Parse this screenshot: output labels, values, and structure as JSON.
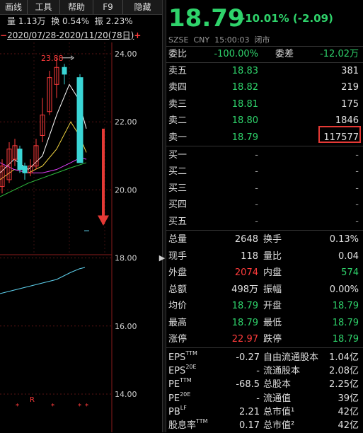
{
  "toolbar": {
    "items": [
      "画线",
      "工具",
      "帮助",
      "F9",
      "隐藏"
    ]
  },
  "info": {
    "volume": "量 1.13万",
    "turnover": "换 0.54%",
    "amplitude": "振 2.23%"
  },
  "range": {
    "minus": "−",
    "text": "2020/07/28-2020/11/20(78日)",
    "plus": "+"
  },
  "chart": {
    "max_label": "23.88",
    "axis_labels": [
      "24.00",
      "22.00",
      "20.00",
      "18.00",
      "16.00",
      "14.00"
    ],
    "marks": [
      "*",
      "R",
      "*",
      "*",
      "*"
    ]
  },
  "chart_data": {
    "type": "candlestick",
    "ylim": [
      13.6,
      24.4
    ],
    "y_ticks": [
      24,
      22,
      20,
      18,
      16,
      14
    ],
    "max_annotation": 23.88,
    "candles": [
      {
        "o": 20.1,
        "c": 20.7,
        "h": 20.9,
        "l": 19.9,
        "up": true
      },
      {
        "o": 20.3,
        "c": 21.2,
        "h": 21.4,
        "l": 20.2,
        "up": true
      },
      {
        "o": 20.9,
        "c": 21.3,
        "h": 21.5,
        "l": 20.7,
        "up": true
      },
      {
        "o": 20.6,
        "c": 21.2,
        "h": 21.3,
        "l": 20.5,
        "up": false
      },
      {
        "o": 20.5,
        "c": 20.7,
        "h": 20.8,
        "l": 20.3,
        "up": false
      },
      {
        "o": 20.5,
        "c": 20.7,
        "h": 20.9,
        "l": 20.4,
        "up": true
      },
      {
        "o": 20.7,
        "c": 21.3,
        "h": 21.5,
        "l": 20.6,
        "up": true
      },
      {
        "o": 21.6,
        "c": 22.2,
        "h": 22.7,
        "l": 21.4,
        "up": true
      },
      {
        "o": 22.3,
        "c": 23.3,
        "h": 23.5,
        "l": 22.2,
        "up": true
      },
      {
        "o": 23.1,
        "c": 23.6,
        "h": 23.88,
        "l": 22.7,
        "up": true
      },
      {
        "o": 23.6,
        "c": 23.4,
        "h": 23.7,
        "l": 23.1,
        "up": false
      },
      {
        "o": 23.3,
        "c": 20.8,
        "h": 23.4,
        "l": 20.8,
        "up": false
      }
    ],
    "lower": {
      "type": "line",
      "color": "#5fd3f0"
    }
  },
  "quote": {
    "price": "18.79",
    "change": "-10.01% (-2.09)",
    "exchange": "SZSE",
    "currency": "CNY",
    "time": "15:00:03",
    "status": "闭市",
    "weibi_label": "委比",
    "weibi_value": "-100.00%",
    "weicha_label": "委差",
    "weicha_value": "-12.02万",
    "sell": [
      {
        "label": "卖五",
        "price": "18.83",
        "vol": "381"
      },
      {
        "label": "卖四",
        "price": "18.82",
        "vol": "219"
      },
      {
        "label": "卖三",
        "price": "18.81",
        "vol": "175"
      },
      {
        "label": "卖二",
        "price": "18.80",
        "vol": "1846"
      },
      {
        "label": "卖一",
        "price": "18.79",
        "vol": "117577"
      }
    ],
    "buy": [
      {
        "label": "买一",
        "price": "-",
        "vol": "-"
      },
      {
        "label": "买二",
        "price": "-",
        "vol": "-"
      },
      {
        "label": "买三",
        "price": "-",
        "vol": "-"
      },
      {
        "label": "买四",
        "price": "-",
        "vol": "-"
      },
      {
        "label": "买五",
        "price": "-",
        "vol": "-"
      }
    ],
    "stats": [
      {
        "l1": "总量",
        "v1": "2648",
        "c1": "w",
        "l2": "换手",
        "v2": "0.13%",
        "c2": "w"
      },
      {
        "l1": "现手",
        "v1": "118",
        "c1": "w",
        "l2": "量比",
        "v2": "0.04",
        "c2": "w"
      },
      {
        "l1": "外盘",
        "v1": "2074",
        "c1": "r",
        "l2": "内盘",
        "v2": "574",
        "c2": "g"
      },
      {
        "l1": "总额",
        "v1": "498万",
        "c1": "w",
        "l2": "振幅",
        "v2": "0.00%",
        "c2": "w"
      },
      {
        "l1": "均价",
        "v1": "18.79",
        "c1": "g",
        "l2": "开盘",
        "v2": "18.79",
        "c2": "g"
      },
      {
        "l1": "最高",
        "v1": "18.79",
        "c1": "g",
        "l2": "最低",
        "v2": "18.79",
        "c2": "g"
      },
      {
        "l1": "涨停",
        "v1": "22.97",
        "c1": "r",
        "l2": "跌停",
        "v2": "18.79",
        "c2": "g"
      }
    ],
    "fundamentals": [
      {
        "l1": "EPS",
        "s1": "TTM",
        "v1": "-0.27",
        "l2": "自由流通股本",
        "v2": "1.04亿"
      },
      {
        "l1": "EPS",
        "s1": "20E",
        "v1": "-",
        "l2": "流通股本",
        "v2": "2.08亿"
      },
      {
        "l1": "PE",
        "s1": "TTM",
        "v1": "-68.5",
        "l2": "总股本",
        "v2": "2.25亿"
      },
      {
        "l1": "PE",
        "s1": "20E",
        "v1": "-",
        "l2": "流通值",
        "v2": "39亿"
      },
      {
        "l1": "PB",
        "s1": "LF",
        "v1": "2.21",
        "l2": "总市值¹",
        "v2": "42亿"
      },
      {
        "l1": "股息率",
        "s1": "TTM",
        "v1": "0.17",
        "l2": "总市值²",
        "v2": "42亿"
      }
    ]
  },
  "colors": {
    "up": "#ff3b3b",
    "down": "#2fd36b",
    "candle_up": "#ff3b3b",
    "candle_down": "#3ad6d6",
    "ma5": "#ffffff",
    "ma10": "#f5d742",
    "ma20": "#e040fb",
    "ma60": "#2fbf3f"
  }
}
